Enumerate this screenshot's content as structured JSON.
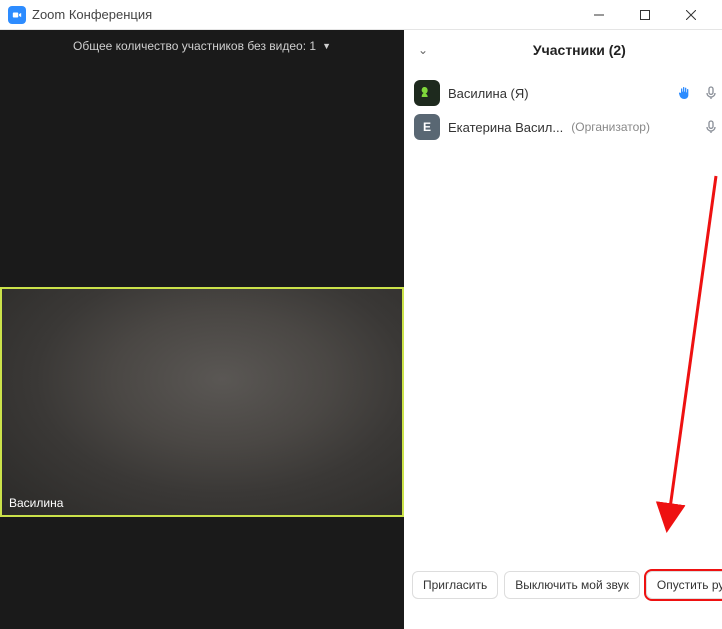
{
  "window": {
    "title": "Zoom Конференция"
  },
  "video": {
    "no_video_count_label": "Общее количество участников без видео: 1",
    "tile_name": "Василина"
  },
  "participants": {
    "header": "Участники (2)",
    "items": [
      {
        "name": "Василина (Я)",
        "role": "",
        "avatar_letter": "",
        "hand_raised": true,
        "mic_muted": false,
        "cam_off": false,
        "cam_stroked": false
      },
      {
        "name": "Екатерина Васил...",
        "role": "(Организатор)",
        "avatar_letter": "Е",
        "hand_raised": false,
        "mic_muted": false,
        "cam_off": true,
        "cam_stroked": true
      }
    ]
  },
  "footer": {
    "invite": "Пригласить",
    "mute_me": "Выключить мой звук",
    "lower_hand": "Опустить руку"
  }
}
